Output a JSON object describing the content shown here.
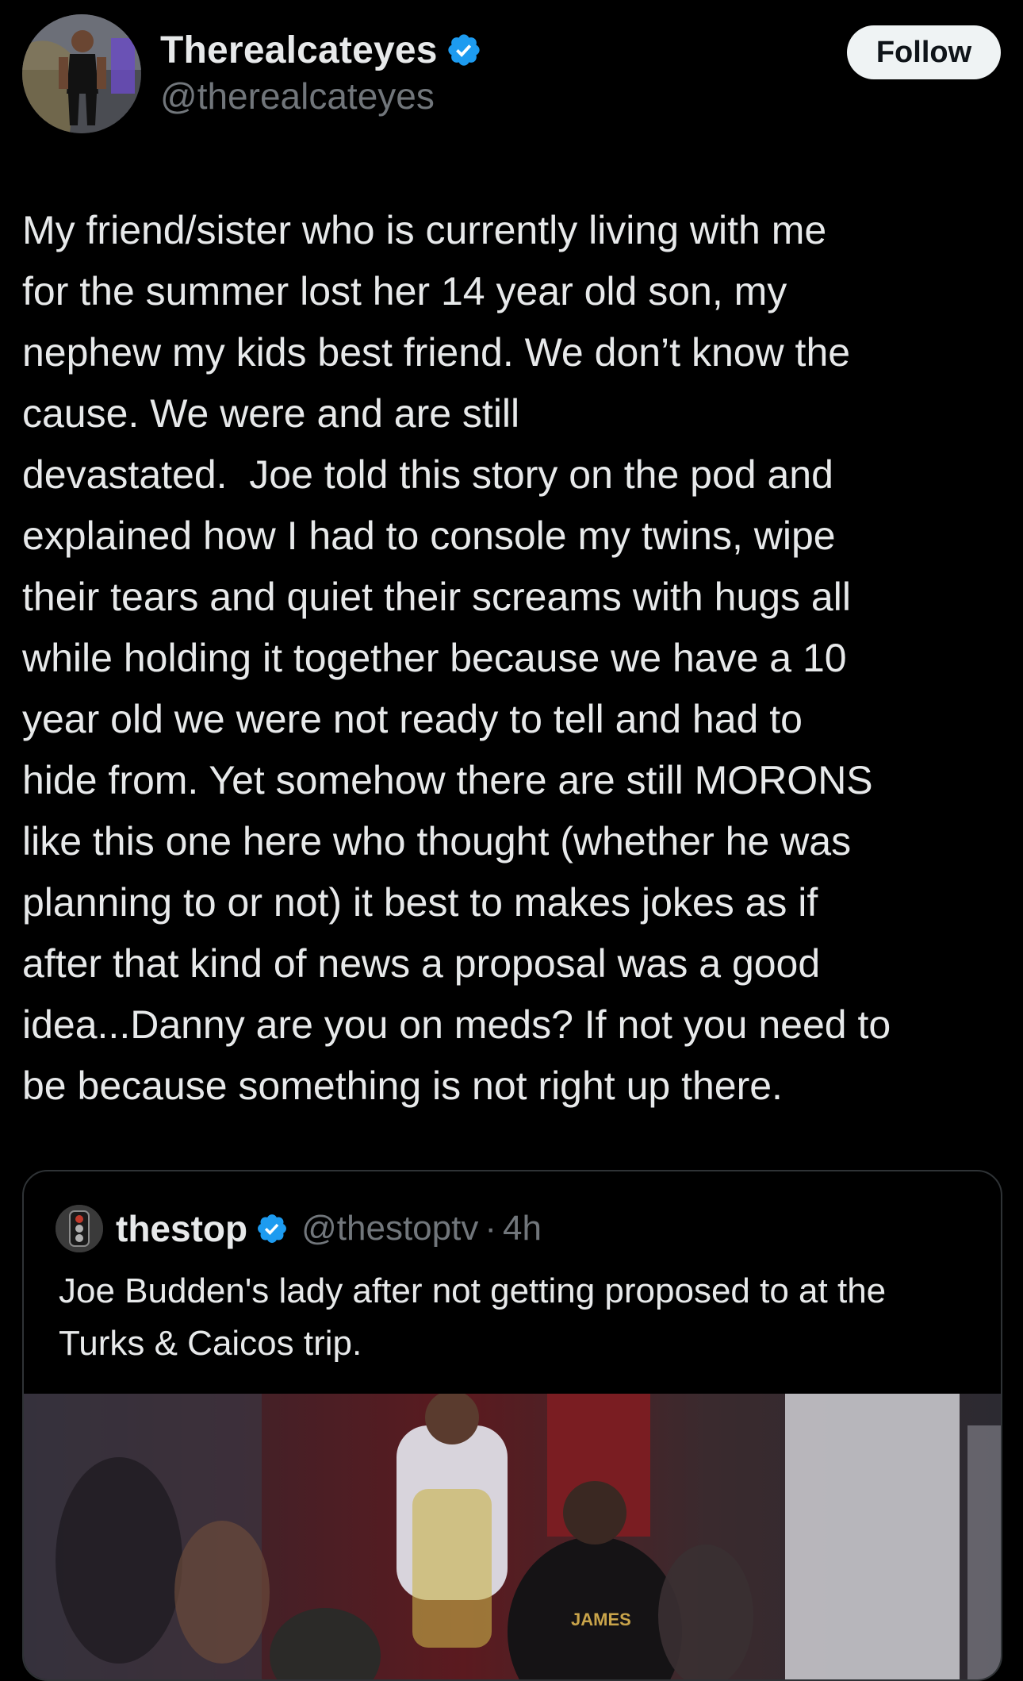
{
  "author": {
    "display_name": "Therealcateyes",
    "handle": "@therealcateyes",
    "verified_icon": "verified-badge-icon",
    "follow_label": "Follow"
  },
  "tweet": {
    "text": "My friend/sister who is currently living with me\nfor the summer lost her 14 year old son, my\nnephew my kids best friend. We don’t know the\ncause. We were and are still\ndevastated.  Joe told this story on the pod and\nexplained how I had to console my twins, wipe\ntheir tears and quiet their screams with hugs all\nwhile holding it together because we have a 10\nyear old we were not ready to tell and had to\nhide from. Yet somehow there are still MORONS\nlike this one here who thought (whether he was\nplanning to or not) it best to makes jokes as if\nafter that kind of news a proposal was a good\nidea...Danny are you on meds? If not you need to\nbe because something is not right up there."
  },
  "quoted_tweet": {
    "display_name": "thestop",
    "handle": "@thestoptv",
    "separator": "·",
    "time": "4h",
    "text": "Joe Budden's lady after not getting proposed to at the Turks & Caicos trip.",
    "media_jersey_text": "JAMES"
  },
  "colors": {
    "background": "#000000",
    "text_primary": "#e7e9ea",
    "text_secondary": "#71767b",
    "verified_blue": "#1d9bf0",
    "border": "#2f3336",
    "follow_bg": "#eff3f4"
  }
}
